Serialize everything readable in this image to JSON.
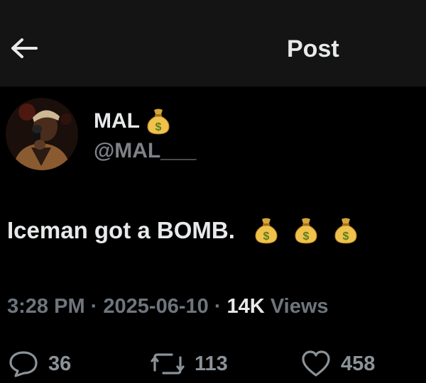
{
  "header": {
    "title": "Post"
  },
  "author": {
    "name": "MAL",
    "handle": "@MAL___"
  },
  "post": {
    "text": "Iceman got a BOMB.",
    "emoji": [
      "money-bag",
      "money-bag",
      "money-bag"
    ]
  },
  "meta": {
    "time": "3:28 PM",
    "date": "2025-06-10",
    "sep": "·",
    "views_count": "14K",
    "views_label": "Views"
  },
  "actions": {
    "replies": "36",
    "reposts": "113",
    "likes": "458"
  },
  "colors": {
    "background": "#000000",
    "topbar": "#141414",
    "text": "#e7e9ea",
    "muted": "#6e757c"
  }
}
